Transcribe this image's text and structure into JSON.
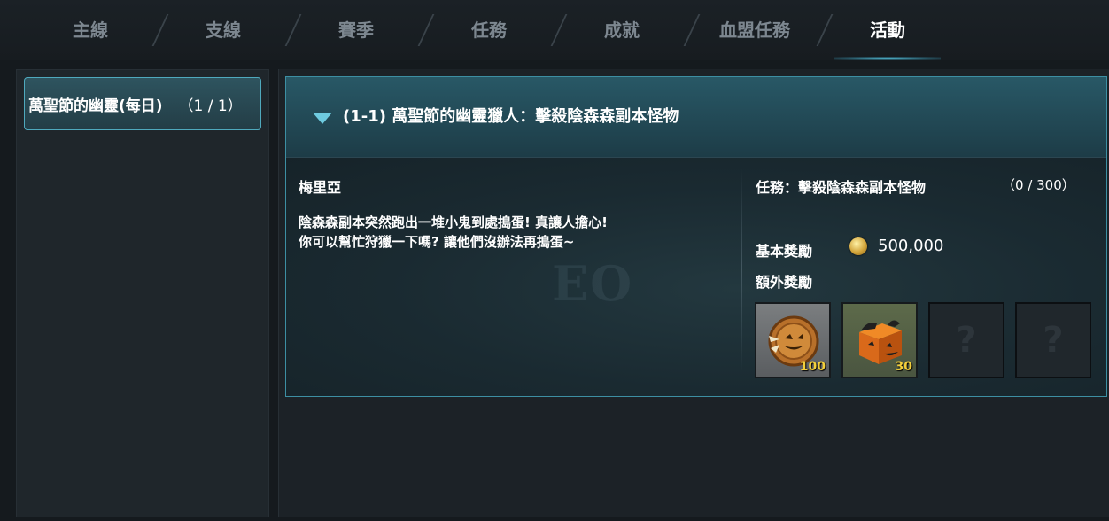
{
  "tabs": [
    {
      "label": "主線",
      "active": false
    },
    {
      "label": "支線",
      "active": false
    },
    {
      "label": "賽季",
      "active": false
    },
    {
      "label": "任務",
      "active": false
    },
    {
      "label": "成就",
      "active": false
    },
    {
      "label": "血盟任務",
      "active": false
    },
    {
      "label": "活動",
      "active": true
    }
  ],
  "sidebar": {
    "items": [
      {
        "label": "萬聖節的幽靈(每日)",
        "count": "（1 / 1）"
      }
    ]
  },
  "quest": {
    "title": "(1-1) 萬聖節的幽靈獵人：擊殺陰森森副本怪物",
    "npc_name": "梅里亞",
    "dialog_line1": "陰森森副本突然跑出一堆小鬼到處搗蛋! 真讓人擔心!",
    "dialog_line2": "你可以幫忙狩獵一下嗎? 讓他們沒辦法再搗蛋~",
    "objective": "任務：擊殺陰森森副本怪物",
    "progress": "（0 / 300）",
    "base_reward_label": "基本獎勵",
    "base_reward_amount": "500,000",
    "extra_reward_label": "額外獎勵",
    "extra_rewards": [
      {
        "icon": "halloween-coin-icon",
        "quantity": "100"
      },
      {
        "icon": "pumpkin-box-icon",
        "quantity": "30"
      },
      {
        "icon": "locked-reward-icon",
        "quantity": ""
      },
      {
        "icon": "locked-reward-icon",
        "quantity": ""
      }
    ]
  },
  "colors": {
    "accent": "#57c6e0",
    "active_tab_text": "#ffffff",
    "inactive_tab_text": "#7d8790",
    "quantity_text": "#f3cf3b"
  }
}
